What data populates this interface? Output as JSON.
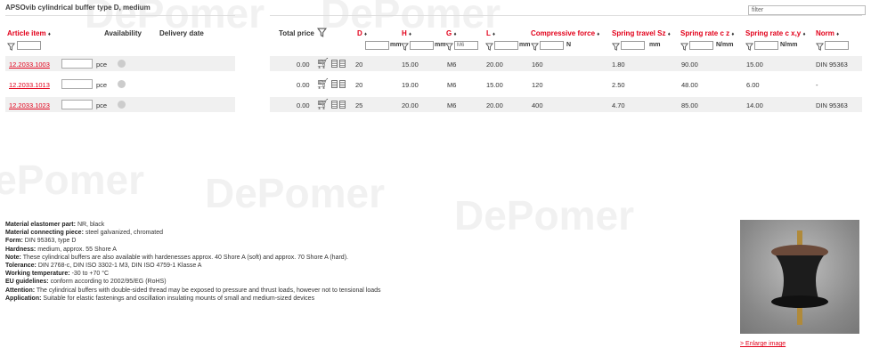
{
  "title": "APSOvib cylindrical buffer type D, medium",
  "filter": {
    "placeholder": "filter"
  },
  "headers": {
    "article_item": "Article item",
    "availability": "Availability",
    "delivery_date": "Delivery date",
    "total_price": "Total price",
    "d": "D",
    "h": "H",
    "g": "G",
    "l": "L",
    "compressive_force": "Compressive force",
    "spring_travel": "Spring travel Sz",
    "spring_rate_cz": "Spring rate c z",
    "spring_rate_cxy": "Spring rate c x,y",
    "norm": "Norm",
    "sort_marker": "♦"
  },
  "filter_row": {
    "units": {
      "d": "mm",
      "h": "mm",
      "g": "mm",
      "l": "mm",
      "compressive_force": "N",
      "spring_travel": "mm",
      "spring_rate_cz": "N/mm",
      "spring_rate_cxy": "N/mm"
    },
    "g_value": "M6"
  },
  "rows": [
    {
      "article": "12.2033.1003",
      "unit": "pce",
      "price": "0.00",
      "d": "20",
      "h": "15.00",
      "g": "M6",
      "l": "20.00",
      "force": "160",
      "travel": "1.80",
      "cz": "90.00",
      "cxy": "15.00",
      "norm": "DIN 95363"
    },
    {
      "article": "12.2033.1013",
      "unit": "pce",
      "price": "0.00",
      "d": "20",
      "h": "19.00",
      "g": "M6",
      "l": "15.00",
      "force": "120",
      "travel": "2.50",
      "cz": "48.00",
      "cxy": "6.00",
      "norm": "-"
    },
    {
      "article": "12.2033.1023",
      "unit": "pce",
      "price": "0.00",
      "d": "25",
      "h": "20.00",
      "g": "M6",
      "l": "20.00",
      "force": "400",
      "travel": "4.70",
      "cz": "85.00",
      "cxy": "14.00",
      "norm": "DIN 95363"
    }
  ],
  "description": [
    {
      "label": "Material elastomer part:",
      "text": "NR, black"
    },
    {
      "label": "Material connecting piece:",
      "text": "steel galvanized, chromated"
    },
    {
      "label": "Form:",
      "text": "DIN 95363, type D"
    },
    {
      "label": "Hardness:",
      "text": "medium, approx. 55 Shore A"
    },
    {
      "label": "Note:",
      "text": "These cylindrical buffers are also available with hardenesses approx. 40 Shore A (soft) and approx. 70 Shore A (hard)."
    },
    {
      "label": "Tolerance:",
      "text": "DIN 2768-c, DIN ISO 3302-1 M3, DIN ISO 4759-1 Klasse A"
    },
    {
      "label": "Working temperature:",
      "text": "-30 to +70 °C"
    },
    {
      "label": "EU guidelines:",
      "text": "conform according to 2002/95/EG (RoHS)"
    },
    {
      "label": "Attention:",
      "text": "The cylindrical buffers with double-sided thread may be exposed to pressure and thrust loads, however not to tensional loads"
    },
    {
      "label": "Application:",
      "text": "Suitable for elastic fastenings and oscillation insulating mounts of small and medium-sized devices"
    }
  ],
  "enlarge_link": "> Enlarge image",
  "watermark": "DePomer",
  "colors": {
    "accent": "#e2001a",
    "row_bg": "#f0f0f0"
  },
  "icons": [
    "filter-funnel-icon",
    "cart-icon",
    "datasheet-icon",
    "cad-icon",
    "availability-dot-icon"
  ]
}
